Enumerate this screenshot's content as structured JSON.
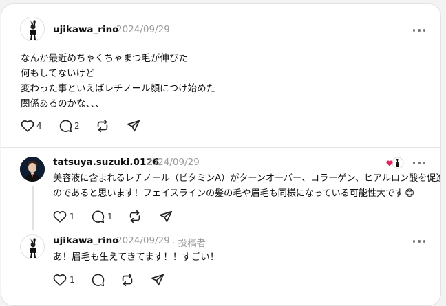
{
  "post": {
    "username": "ujikawa_rino",
    "date": "2024/09/29",
    "lines": [
      "なんか最近めちゃくちゃまつ毛が伸びた",
      "何もしてないけど",
      "変わった事といえばレチノール顔につけ始めた",
      "関係あるのかな、、、"
    ],
    "like_count": "4",
    "reply_count": "2"
  },
  "reply1": {
    "username": "tatsuya.suzuki.0126",
    "date": "2024/09/29",
    "lines": [
      "美容液に含まれるレチノール（ビタミンA）がターンオーバー、コラーゲン、ヒアルロン酸を促進する",
      "のであると思います！フェイスラインの髪の毛や眉毛も同様になっている可能性大です"
    ],
    "emoji": "😊",
    "like_count": "1",
    "reply_count": "1"
  },
  "reply2": {
    "username": "ujikawa_rino",
    "date": "2024/09/29",
    "author_badge": "· 投稿者",
    "lines": [
      "あ！眉毛も生えてきてます！！すごい！"
    ],
    "like_count": "1"
  },
  "icons": {
    "like": "heart-icon",
    "reply": "comment-icon",
    "repost": "repost-icon",
    "share": "share-icon",
    "more": "more-options-icon"
  }
}
